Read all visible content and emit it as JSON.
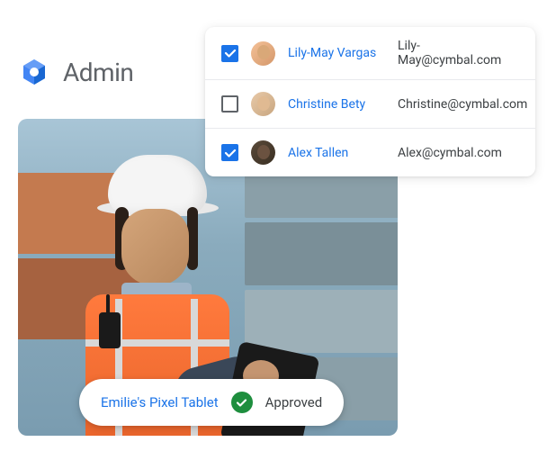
{
  "header": {
    "product_name": "Admin"
  },
  "users": [
    {
      "name": "Lily-May Vargas",
      "email": "Lily-May@cymbal.com",
      "checked": true
    },
    {
      "name": "Christine Bety",
      "email": "Christine@cymbal.com",
      "checked": false
    },
    {
      "name": "Alex Tallen",
      "email": "Alex@cymbal.com",
      "checked": true
    }
  ],
  "approval": {
    "device_name": "Emilie's Pixel Tablet",
    "status": "Approved"
  }
}
